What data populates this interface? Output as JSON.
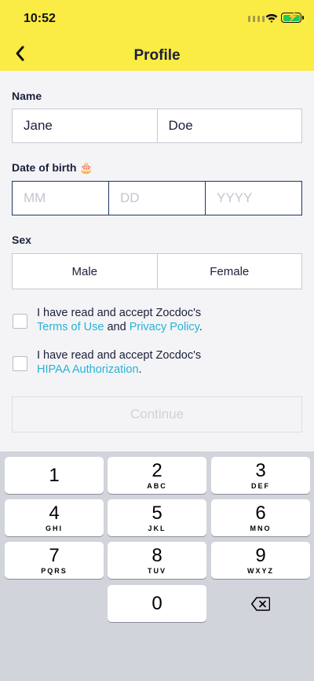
{
  "status_bar": {
    "time": "10:52"
  },
  "header": {
    "title": "Profile"
  },
  "form": {
    "name_label": "Name",
    "first_name": "Jane",
    "last_name": "Doe",
    "dob_label": "Date of birth 🎂",
    "dob_mm_placeholder": "MM",
    "dob_dd_placeholder": "DD",
    "dob_yyyy_placeholder": "YYYY",
    "sex_label": "Sex",
    "sex_options": [
      "Male",
      "Female"
    ],
    "consent_1": {
      "prefix": "I have read and accept Zocdoc's",
      "link1": "Terms of Use",
      "middle": "and",
      "link2": "Privacy Policy",
      "suffix": "."
    },
    "consent_2": {
      "prefix": "I have read and accept Zocdoc's",
      "link1": "HIPAA Authorization",
      "suffix": "."
    },
    "continue_label": "Continue"
  },
  "keyboard": {
    "keys": [
      {
        "num": "1",
        "letters": ""
      },
      {
        "num": "2",
        "letters": "ABC"
      },
      {
        "num": "3",
        "letters": "DEF"
      },
      {
        "num": "4",
        "letters": "GHI"
      },
      {
        "num": "5",
        "letters": "JKL"
      },
      {
        "num": "6",
        "letters": "MNO"
      },
      {
        "num": "7",
        "letters": "PQRS"
      },
      {
        "num": "8",
        "letters": "TUV"
      },
      {
        "num": "9",
        "letters": "WXYZ"
      },
      {
        "num": "0",
        "letters": ""
      }
    ],
    "delete_icon": "backspace-icon"
  },
  "colors": {
    "header_bg": "#fbeb45",
    "link": "#27b3d6",
    "navy": "#1f3466"
  }
}
